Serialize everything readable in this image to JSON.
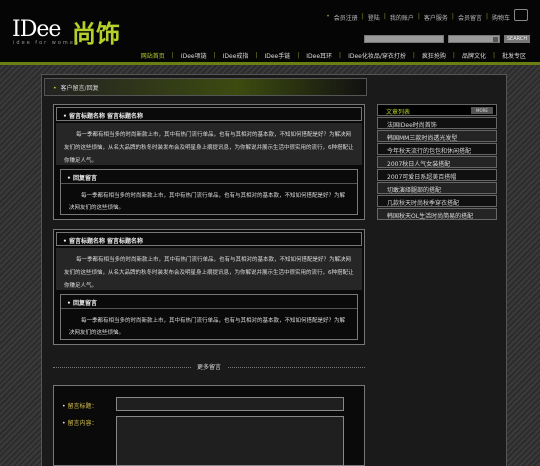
{
  "brand": {
    "logo_text": "IDee",
    "logo_cn": "尚饰",
    "logo_sub": "idee for women"
  },
  "toplinks": [
    "会员注册",
    "登陆",
    "我的账户",
    "客户服务",
    "会员留言",
    "购物车"
  ],
  "search": {
    "button": "SEARCH"
  },
  "nav": [
    "网站首页",
    "IDee项链",
    "IDee戒指",
    "IDee手链",
    "IDee耳环",
    "IDee化妆品/穿衣打扮",
    "疯狂抢购",
    "品牌文化",
    "批发专区"
  ],
  "breadcrumb": "客户留言/回复",
  "messages": [
    {
      "title": "留言标题名称  留言标题名称",
      "body": "每一季都有相当多的时尚新款上市，其中有热门流行单品，也有与其相对的基本款，不知如何搭配是好？为解决网友们的这些烦恼，从名大品牌的秋冬时装发布会及明星身上摘提讯息，为你解说并展示生活中很实用的流行，6种搭配让你赚足人气。",
      "reply_title": "回复留言",
      "reply_body": "每一季都有相当多的时尚新款上市，其中有热门流行单品，也有与其相对的基本款，不知如何搭配是好？为解决网友们的这些烦恼。"
    },
    {
      "title": "留言标题名称  留言标题名称",
      "body": "每一季都有相当多的时尚新款上市，其中有热门流行单品，也有与其相对的基本款，不知如何搭配是好？为解决网友们的这些烦恼，从名大品牌的秋冬时装发布会及明星身上摘提讯息，为你解说并展示生活中很实用的流行，6种搭配让你赚足人气。",
      "reply_title": "回复留言",
      "reply_body": "每一季都有相当多的时尚新款上市，其中有热门流行单品，也有与其相对的基本款，不知如何搭配是好？为解决网友们的这些烦恼。"
    }
  ],
  "more_label": "更多留言",
  "form": {
    "title_label": "留言标题：",
    "content_label": "留言内容："
  },
  "sidebar": {
    "heading": "文章列表",
    "more": "MORE",
    "items": [
      "法国IDee时尚首饰",
      "韩国MM三款时尚透光发型",
      "今年秋天流行的包包和休闲搭配",
      "2007秋日人气女装搭配",
      "2007可爱日系超美百搭帽",
      "切敢演绎腿部的搭配",
      "几款秋天时尚秋季穿衣搭配",
      "韩国秋天OL生活时尚简易的搭配"
    ]
  }
}
